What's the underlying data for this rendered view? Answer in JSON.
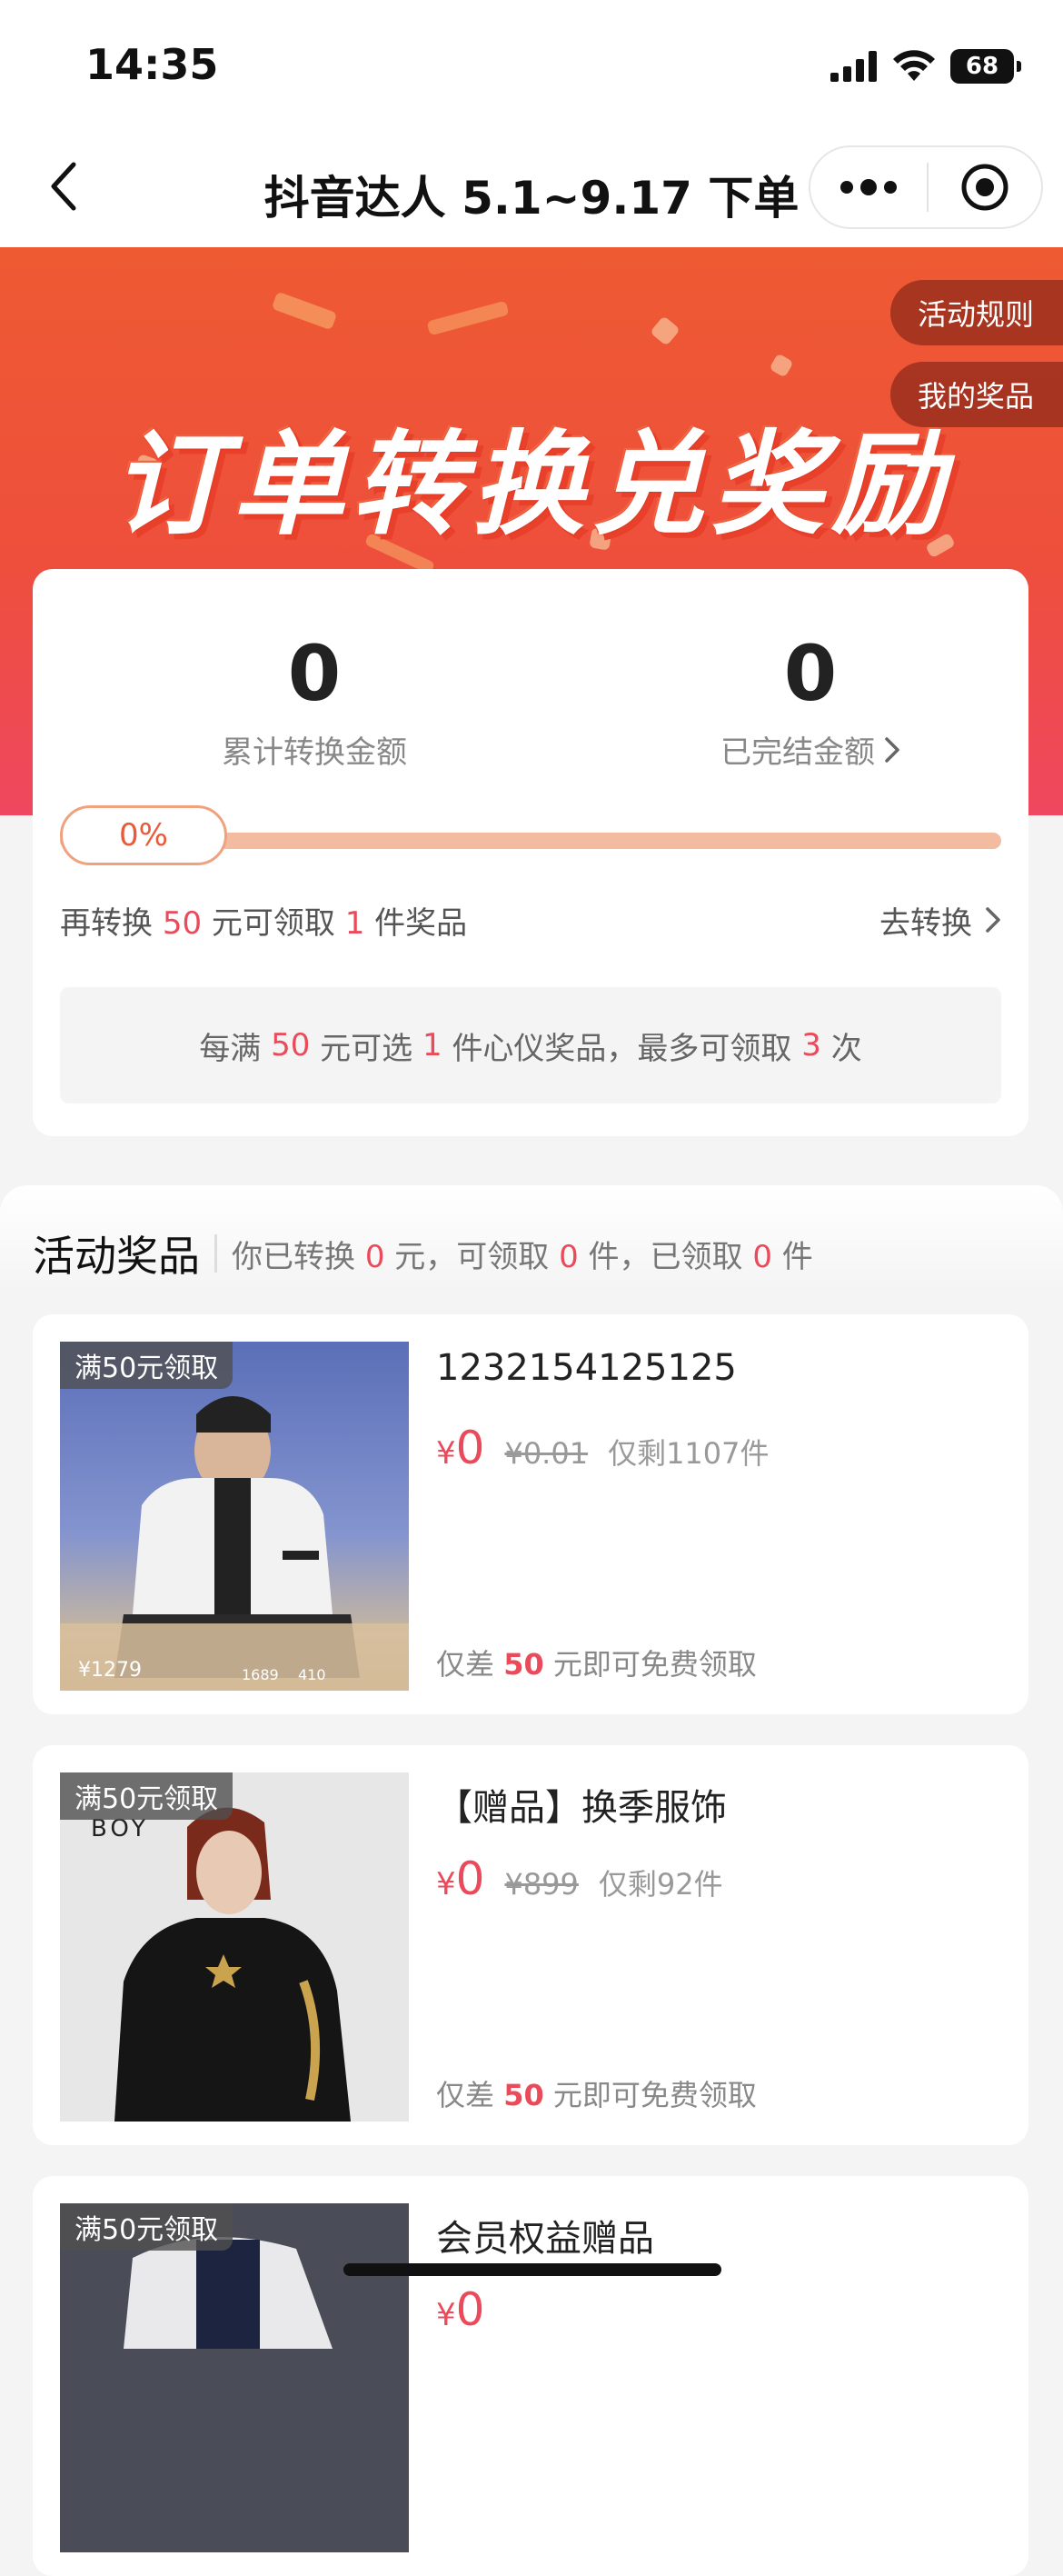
{
  "status_bar": {
    "time": "14:35",
    "battery": "68",
    "icons": [
      "signal-icon",
      "wifi-icon",
      "battery-icon"
    ]
  },
  "nav": {
    "title": "抖音达人 5.1~9.17 下单",
    "icons": [
      "back-icon",
      "more-icon",
      "close-miniapp-icon"
    ]
  },
  "hero": {
    "title": "订单转换兑奖励",
    "rules_label": "活动规则",
    "my_prizes_label": "我的奖品",
    "colors": {
      "top": "#ee5a32",
      "bottom": "#ef4760"
    }
  },
  "summary": {
    "cumulative_value": "0",
    "cumulative_label": "累计转换金额",
    "completed_value": "0",
    "completed_label": "已完结金额",
    "progress_text": "0%",
    "progress_fraction": 0,
    "convert_prefix": "再转换",
    "convert_amount": "50",
    "convert_mid": "元可领取",
    "convert_count": "1",
    "convert_suffix": "件奖品",
    "go_convert_label": "去转换",
    "notice": {
      "p1": "每满",
      "amount": "50",
      "p2": "元可选",
      "count": "1",
      "p3": "件心仪奖品，最多可领取",
      "max": "3",
      "p4": "次"
    },
    "accent_color": "#ea4a5a"
  },
  "prizes": {
    "title": "活动奖品",
    "sub": {
      "p1": "你已转换",
      "converted": "0",
      "p2": "元，可领取",
      "claimable": "0",
      "p3": "件，已领取",
      "claimed": "0",
      "p4": "件"
    },
    "items": [
      {
        "badge": "满50元领取",
        "name": "1232154125125",
        "yen": "¥",
        "price": "0",
        "original_price": "¥0.01",
        "stock": "仅剩1107件",
        "gap_prefix": "仅差",
        "gap_amount": "50",
        "gap_suffix": "元即可免费领取"
      },
      {
        "badge": "满50元领取",
        "name": "【赠品】换季服饰",
        "yen": "¥",
        "price": "0",
        "original_price": "¥899",
        "stock": "仅剩92件",
        "gap_prefix": "仅差",
        "gap_amount": "50",
        "gap_suffix": "元即可免费领取"
      },
      {
        "badge": "满50元领取",
        "name": "会员权益赠品",
        "yen": "¥",
        "price": "0"
      }
    ]
  }
}
